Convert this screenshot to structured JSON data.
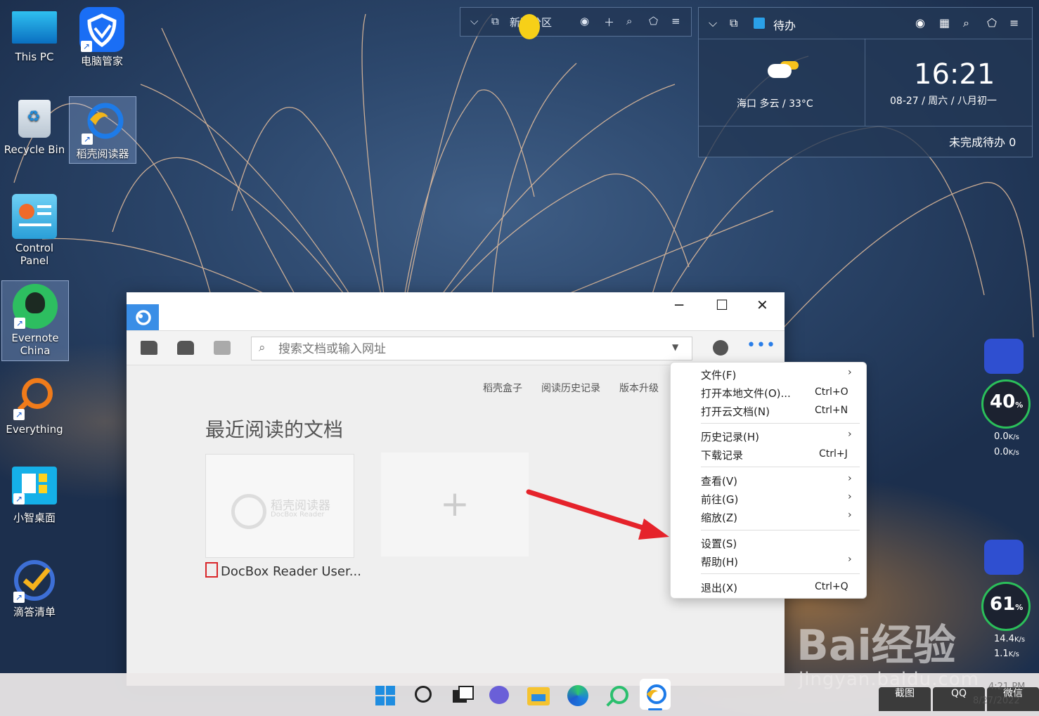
{
  "desktop": {
    "icons": [
      {
        "label": "This PC"
      },
      {
        "label": "电脑管家"
      },
      {
        "label": "Recycle Bin"
      },
      {
        "label": "稻壳阅读器"
      },
      {
        "label": "Control Panel"
      },
      {
        "label": "Evernote China"
      },
      {
        "label": "Everything"
      },
      {
        "label": "小智桌面"
      },
      {
        "label": "滴答清单"
      }
    ]
  },
  "fence_widget": {
    "title": "新建分区"
  },
  "todo_widget": {
    "title": "待办",
    "weather": "海口 多云 / 33°C",
    "time": "16:21",
    "date": "08-27 / 周六 / 八月初一",
    "pending": "未完成待办 0"
  },
  "reader": {
    "search_placeholder": "搜索文档或输入网址",
    "links": [
      "稻壳盒子",
      "阅读历史记录",
      "版本升级"
    ],
    "heading": "最近阅读的文档",
    "doc_logo_cn": "稻壳阅读器",
    "doc_logo_en": "DocBox Reader",
    "recent_doc": "DocBox Reader User..."
  },
  "menu": {
    "items": [
      {
        "label": "文件(F)",
        "shortcut": "",
        "submenu": true
      },
      {
        "label": "打开本地文件(O)...",
        "shortcut": "Ctrl+O",
        "submenu": false
      },
      {
        "label": "打开云文档(N)",
        "shortcut": "Ctrl+N",
        "submenu": false
      },
      {
        "label": "历史记录(H)",
        "shortcut": "",
        "submenu": true
      },
      {
        "label": "下载记录",
        "shortcut": "Ctrl+J",
        "submenu": false
      },
      {
        "label": "查看(V)",
        "shortcut": "",
        "submenu": true
      },
      {
        "label": "前往(G)",
        "shortcut": "",
        "submenu": true
      },
      {
        "label": "缩放(Z)",
        "shortcut": "",
        "submenu": true
      },
      {
        "label": "设置(S)",
        "shortcut": "",
        "submenu": false
      },
      {
        "label": "帮助(H)",
        "shortcut": "",
        "submenu": true
      },
      {
        "label": "退出(X)",
        "shortcut": "Ctrl+Q",
        "submenu": false
      }
    ]
  },
  "monitors": [
    {
      "value": "40",
      "unit": "%",
      "up": "0.0",
      "down": "0.0",
      "rate_unit": "K/s"
    },
    {
      "value": "61",
      "unit": "%",
      "up": "14.4",
      "down": "1.1",
      "rate_unit": "K/s"
    }
  ],
  "tray": {
    "screenshot": "截图",
    "qq": "QQ",
    "wechat": "微信",
    "time": "4:21 PM",
    "date": "8/27/2022"
  },
  "watermark": {
    "brand": "Bai经验",
    "url": "jingyan.baidu.com"
  },
  "colors": {
    "accent": "#3a8ee6",
    "menu_arrow": "#e5232b"
  }
}
